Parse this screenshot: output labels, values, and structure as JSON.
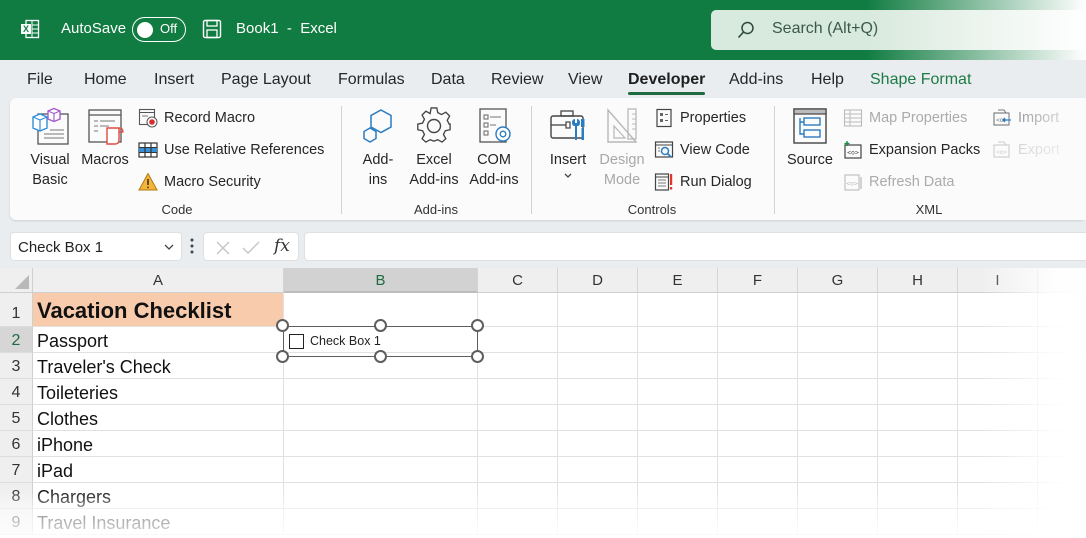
{
  "titlebar": {
    "autosave_label": "AutoSave",
    "autosave_state": "Off",
    "document_title": "Book1  -  Excel",
    "search_placeholder": "Search (Alt+Q)",
    "brand_color": "#107c41"
  },
  "tabs": [
    {
      "label": "File"
    },
    {
      "label": "Home"
    },
    {
      "label": "Insert"
    },
    {
      "label": "Page Layout"
    },
    {
      "label": "Formulas"
    },
    {
      "label": "Data"
    },
    {
      "label": "Review"
    },
    {
      "label": "View"
    },
    {
      "label": "Developer",
      "active": true
    },
    {
      "label": "Add-ins"
    },
    {
      "label": "Help"
    },
    {
      "label": "Shape Format",
      "contextual": true
    }
  ],
  "ribbon": {
    "code": {
      "label": "Code",
      "visual_basic": [
        "Visual",
        "Basic"
      ],
      "macros": "Macros",
      "record_macro": "Record Macro",
      "use_relative_references": "Use Relative References",
      "macro_security": "Macro Security"
    },
    "addins": {
      "label": "Add-ins",
      "addins": [
        "Add-",
        "ins"
      ],
      "excel_addins": [
        "Excel",
        "Add-ins"
      ],
      "com_addins": [
        "COM",
        "Add-ins"
      ]
    },
    "controls": {
      "label": "Controls",
      "insert": "Insert",
      "design_mode": [
        "Design",
        "Mode"
      ],
      "properties": "Properties",
      "view_code": "View Code",
      "run_dialog": "Run Dialog"
    },
    "xml": {
      "label": "XML",
      "source": "Source",
      "map_properties": "Map Properties",
      "expansion_packs": "Expansion Packs",
      "refresh_data": "Refresh Data",
      "import": "Import",
      "export": "Export"
    }
  },
  "formula_bar": {
    "name_box": "Check Box 1",
    "fx_label": "fx",
    "formula": ""
  },
  "sheet": {
    "columns": [
      "A",
      "B",
      "C",
      "D",
      "E",
      "F",
      "G",
      "H",
      "I"
    ],
    "selected_column": "B",
    "rows": [
      {
        "num": "1",
        "a": "Vacation Checklist"
      },
      {
        "num": "2",
        "a": "Passport"
      },
      {
        "num": "3",
        "a": "Traveler's Check"
      },
      {
        "num": "4",
        "a": "Toileteries"
      },
      {
        "num": "5",
        "a": "Clothes"
      },
      {
        "num": "6",
        "a": "iPhone"
      },
      {
        "num": "7",
        "a": "iPad"
      },
      {
        "num": "8",
        "a": "Chargers"
      },
      {
        "num": "9",
        "a": "Travel Insurance"
      }
    ],
    "selected_row": "2",
    "title_fill": "#f8cbad",
    "checkbox_control": {
      "label": "Check Box 1",
      "checked": false
    }
  }
}
